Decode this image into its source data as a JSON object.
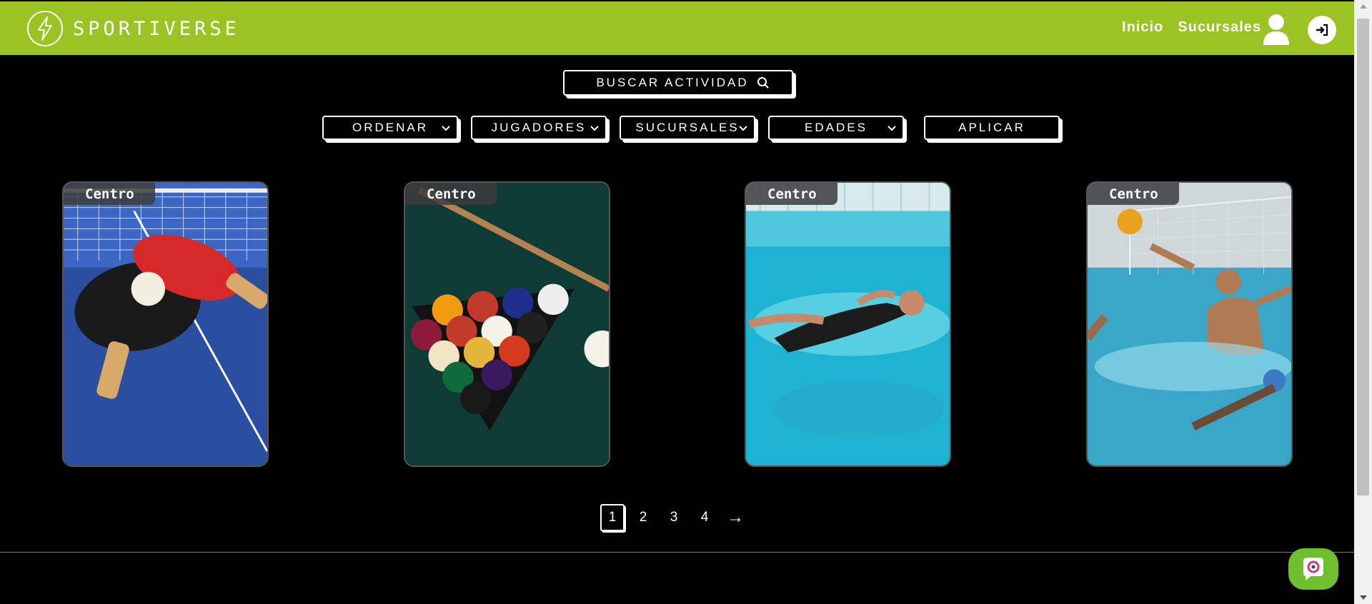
{
  "header": {
    "logo_text": "SPORTIVERSE",
    "nav": [
      "Inicio",
      "Sucursales"
    ],
    "accent_color": "#9ac323"
  },
  "search": {
    "placeholder": "BUSCAR ACTIVIDAD"
  },
  "filters": [
    "ORDENAR",
    "JUGADORES",
    "SUCURSALES",
    "EDADES"
  ],
  "apply_label": "APLICAR",
  "cards": [
    {
      "tag": "Centro",
      "image": "ping-pong-table"
    },
    {
      "tag": "Centro",
      "image": "billiard-balls"
    },
    {
      "tag": "Centro",
      "image": "swimming-pool"
    },
    {
      "tag": "Centro",
      "image": "water-polo"
    }
  ],
  "pagination": {
    "pages": [
      "1",
      "2",
      "3",
      "4"
    ],
    "active": "1",
    "next": "→"
  },
  "footer": {
    "partial_text": ""
  }
}
